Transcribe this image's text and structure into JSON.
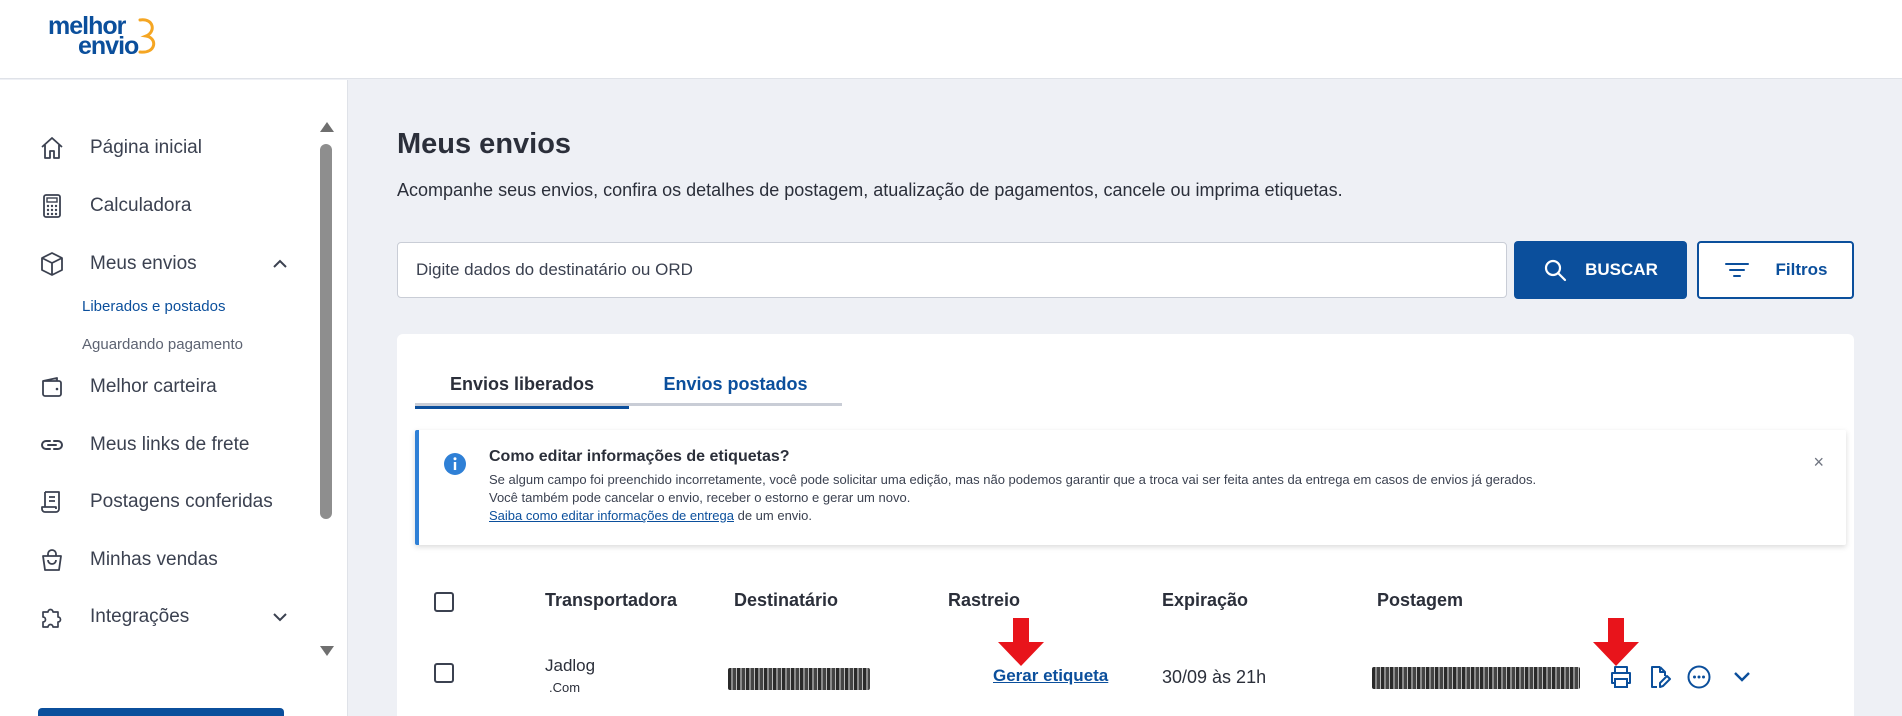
{
  "brand": {
    "logo_line1": "melhor",
    "logo_line2": "envio",
    "accent": "#0b4f9c"
  },
  "sidebar": {
    "items": [
      {
        "label": "Página inicial",
        "icon": "home-icon"
      },
      {
        "label": "Calculadora",
        "icon": "calculator-icon"
      },
      {
        "label": "Meus envios",
        "icon": "box-icon",
        "expanded": true
      },
      {
        "label": "Melhor carteira",
        "icon": "wallet-icon"
      },
      {
        "label": "Meus links de frete",
        "icon": "link-icon"
      },
      {
        "label": "Postagens conferidas",
        "icon": "receipt-icon"
      },
      {
        "label": "Minhas vendas",
        "icon": "shopping-bag-icon"
      },
      {
        "label": "Integrações",
        "icon": "puzzle-icon",
        "expanded": false
      }
    ],
    "subitems": [
      {
        "label": "Liberados e postados",
        "active": true
      },
      {
        "label": "Aguardando pagamento",
        "active": false
      }
    ]
  },
  "main": {
    "title": "Meus envios",
    "description": "Acompanhe seus envios, confira os detalhes de postagem, atualização de pagamentos, cancele ou imprima etiquetas.",
    "search": {
      "placeholder": "Digite dados do destinatário ou ORD",
      "value": ""
    },
    "search_button": "BUSCAR",
    "filter_button": "Filtros",
    "tabs": [
      {
        "label": "Envios liberados",
        "active": true
      },
      {
        "label": "Envios postados",
        "active": false
      }
    ],
    "alert": {
      "title": "Como editar informações de etiquetas?",
      "line1": "Se algum campo foi preenchido incorretamente, você pode solicitar uma edição, mas não podemos garantir que a troca vai ser feita antes da entrega em casos de envios já gerados.",
      "line2": "Você também pode cancelar o envio, receber o estorno e gerar um novo.",
      "link": "Saiba como editar informações de entrega",
      "line3_suffix": " de um envio.",
      "close": "×"
    },
    "table": {
      "headers": [
        "Transportadora",
        "Destinatário",
        "Rastreio",
        "Expiração",
        "Postagem"
      ],
      "rows": [
        {
          "carrier": "Jadlog",
          "carrier_service": ".Com",
          "tracking_action": "Gerar etiqueta",
          "expiration": "30/09 às 21h",
          "actions": [
            "printer-icon",
            "edit-document-icon",
            "more-options-icon",
            "chevron-down-icon"
          ]
        }
      ]
    }
  },
  "annotations": {
    "arrow_color": "#e8141b"
  }
}
